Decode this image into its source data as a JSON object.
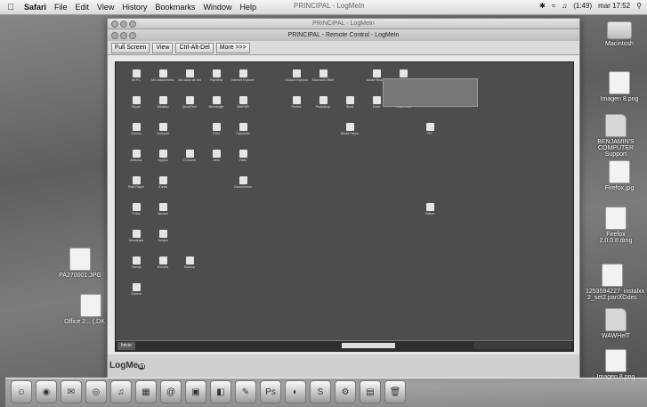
{
  "menubar": {
    "apple": "",
    "items": [
      "Safari",
      "File",
      "Edit",
      "View",
      "History",
      "Bookmarks",
      "Window",
      "Help"
    ],
    "center_title": "PRINCIPAL - LogMeIn",
    "clock": "mar 17:52",
    "battery": "(1:49)"
  },
  "desktop_icons": [
    {
      "label": "Macintosh",
      "icon": "hard-drive-icon"
    },
    {
      "label": "Imagen 8.png",
      "icon": "image-file-icon"
    },
    {
      "label": "BENJAMIN'S COMPUTER Support",
      "icon": "folder-icon"
    },
    {
      "label": "Firefox.jpg",
      "icon": "image-file-icon"
    },
    {
      "label": "Firefox 2.0.0.8.dmg",
      "icon": "disk-image-icon"
    },
    {
      "label": "1253594227_instalxx 2_set2.panXGdec",
      "icon": "document-icon"
    },
    {
      "label": "WAWHelT",
      "icon": "folder-icon"
    },
    {
      "label": "Imagen 8.png",
      "icon": "image-file-icon"
    },
    {
      "label": "PA270001.JPG",
      "icon": "image-file-icon"
    },
    {
      "label": "Office 2... (.DK 1.0)",
      "icon": "document-icon"
    }
  ],
  "window": {
    "outer_title": "PRINCIPAL - LogMeIn",
    "inner_title": "PRINCIPAL - Remote Control - LogMeIn",
    "toolbar": [
      {
        "label": "Full Screen",
        "icon": "fullscreen-icon"
      },
      {
        "label": "View",
        "icon": "view-icon"
      },
      {
        "label": "Ctrl-Alt-Del",
        "icon": "keyboard-icon"
      },
      {
        "label": "More >>>",
        "icon": "more-icon"
      }
    ],
    "logo_text": "LogMe",
    "logo_badge": "In"
  },
  "remote_desktop": {
    "icons": [
      "Mi PC",
      "Mis documentos",
      "Mis sitios de red",
      "Papelera",
      "Internet Explorer",
      "Outlook Express",
      "Microsoft Office",
      "Adobe Reader",
      "Nero",
      "Skype",
      "Winamp",
      "QuickTime",
      "Messenger",
      "WinRAR",
      "Firefox",
      "Photoshop",
      "Word",
      "Excel",
      "PowerPoint",
      "Access",
      "Notepad",
      "Paint",
      "Calculator",
      "Media Player",
      "VLC",
      "Antivirus",
      "Spybot",
      "CCleaner",
      "Java",
      "Flash",
      "Real Player",
      "iTunes",
      "Documentos",
      "Fotos",
      "Musica",
      "Videos",
      "Descargas",
      "Juegos",
      "Trabajo",
      "Escuela",
      "Backup",
      "Drivers"
    ],
    "start_label": "Inicio",
    "taskbar_field": ""
  },
  "dock": {
    "icons": [
      "finder-icon",
      "dashboard-icon",
      "mail-icon",
      "safari-icon",
      "itunes-icon",
      "ical-icon",
      "addressbook-icon",
      "iphoto-icon",
      "preview-icon",
      "textedit-icon",
      "photoshop-icon",
      "firefox-icon",
      "skype-icon",
      "sysprefs-icon",
      "folder-icon",
      "trash-icon"
    ]
  },
  "colors": {
    "menubar": "#e6e6e6",
    "remote_bg": "#4d4d4d",
    "accent": "#222222"
  }
}
